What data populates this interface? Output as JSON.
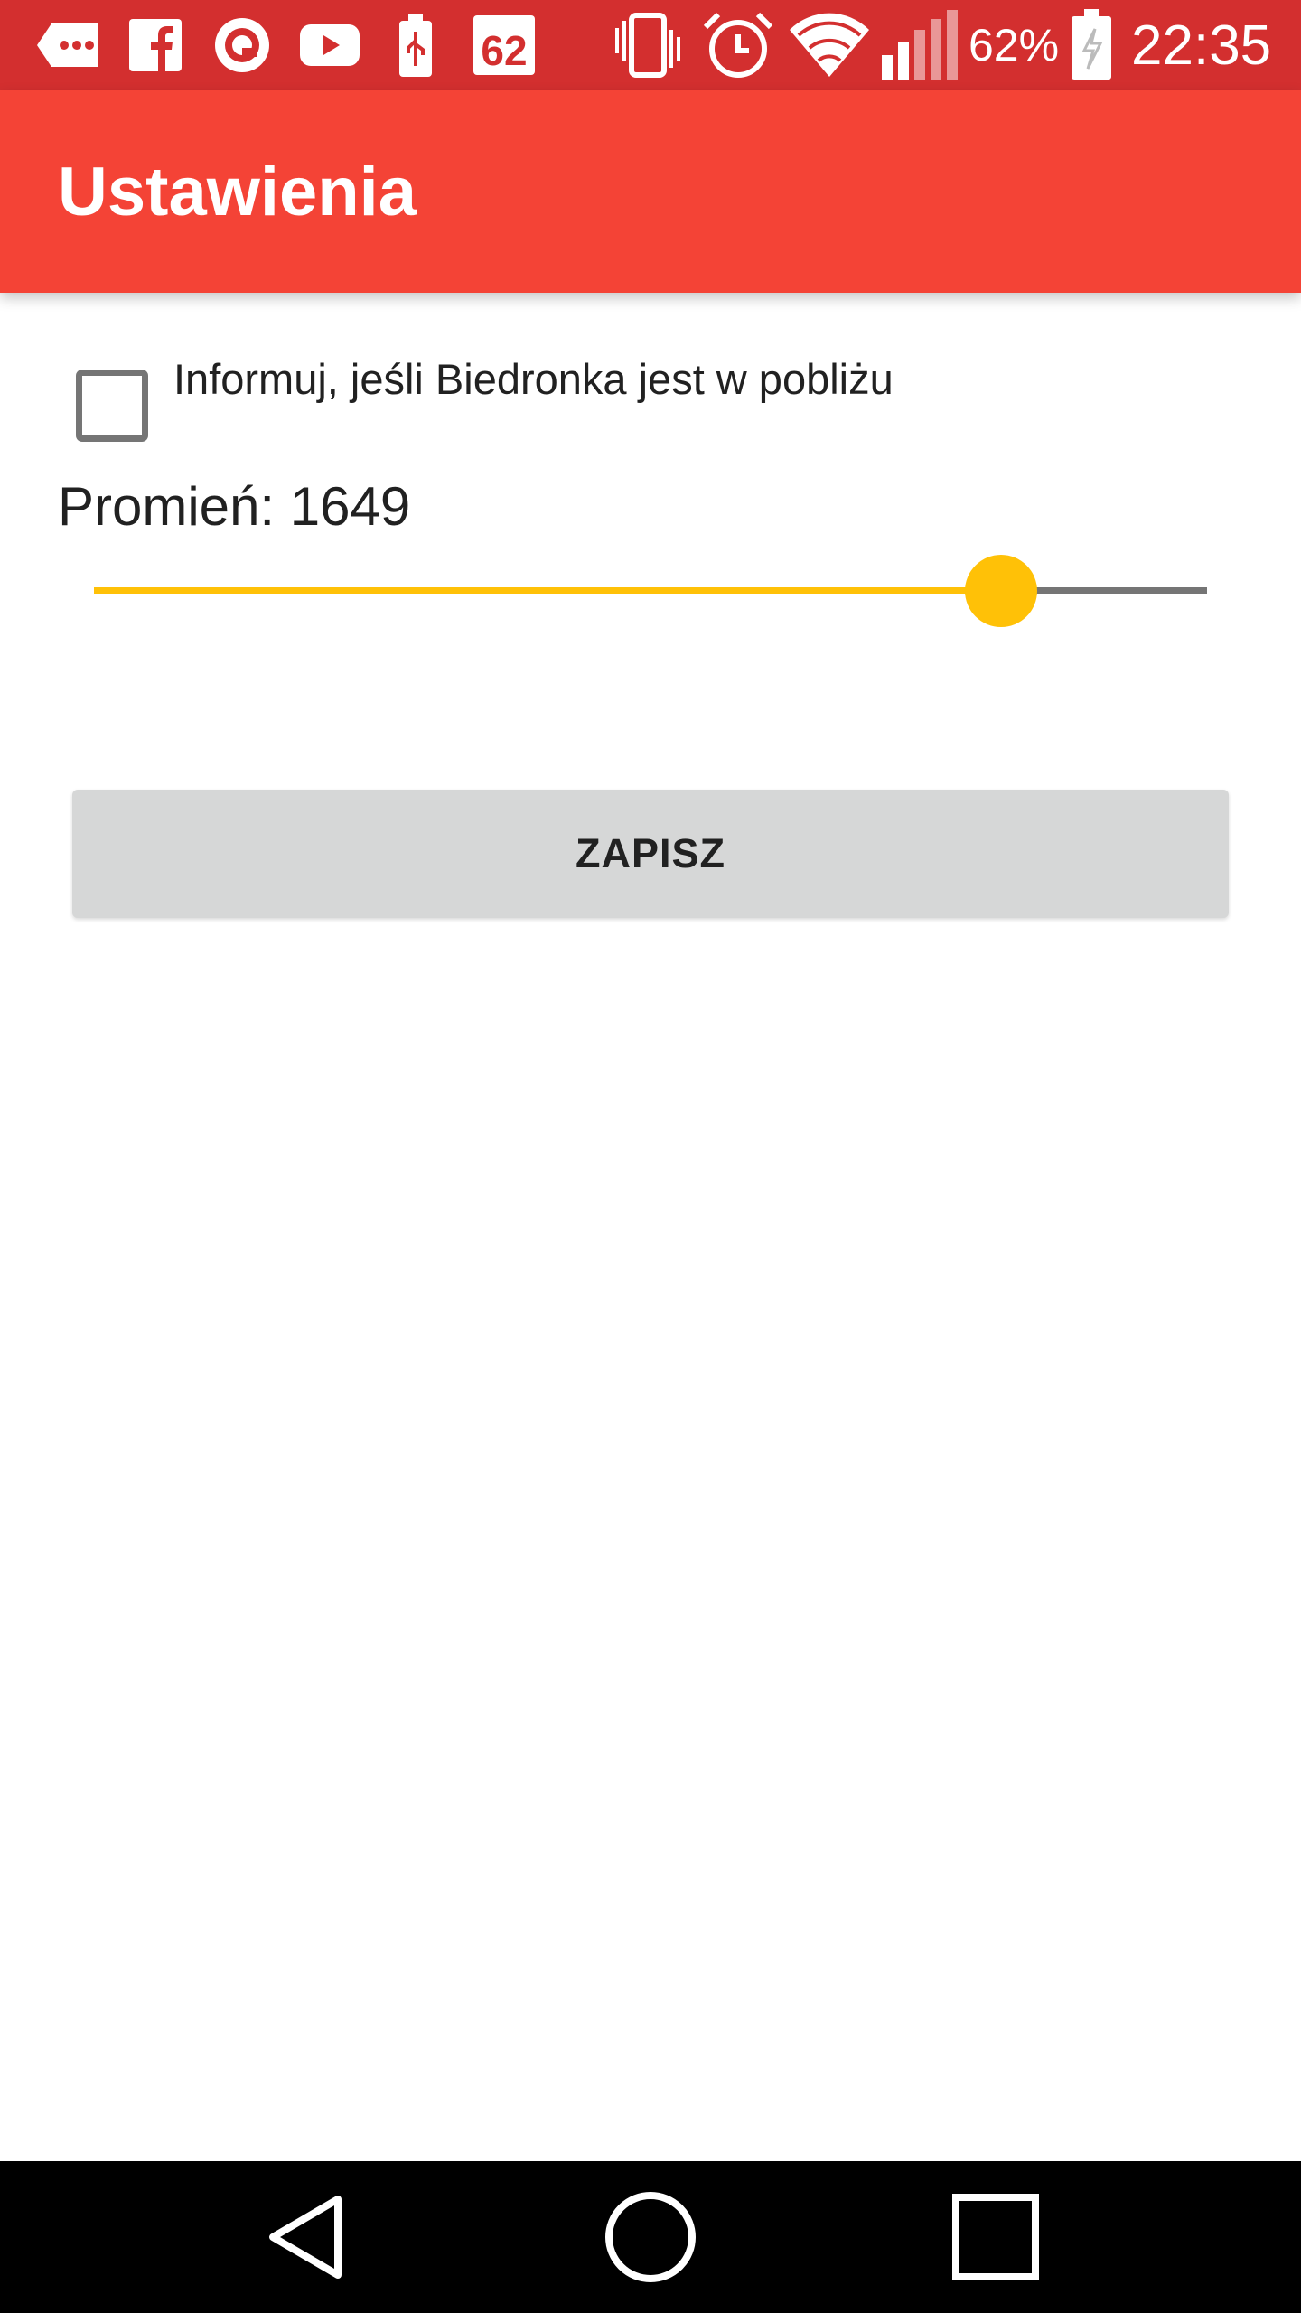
{
  "status_bar": {
    "notification_icons": [
      "messages-icon",
      "facebook-icon",
      "opera-icon",
      "youtube-icon",
      "usb-icon",
      "calendar-icon"
    ],
    "calendar_day": "62",
    "system_icons": [
      "vibrate-icon",
      "alarm-icon",
      "wifi-icon",
      "signal-icon"
    ],
    "battery_percent": "62%",
    "time": "22:35"
  },
  "app_bar": {
    "title": "Ustawienia"
  },
  "settings": {
    "notify_checkbox": {
      "label": "Informuj, jeśli Biedronka jest w pobliżu",
      "checked": false
    },
    "radius": {
      "label": "Promień:",
      "value": "1649",
      "slider_fraction": 0.815
    }
  },
  "save_button": {
    "label": "ZAPISZ"
  },
  "nav_bar": {
    "buttons": [
      "back-icon",
      "home-icon",
      "recents-icon"
    ]
  },
  "colors": {
    "status_bar": "#d32f2f",
    "app_bar": "#f44336",
    "accent": "#ffc107",
    "button": "#d6d7d7"
  }
}
